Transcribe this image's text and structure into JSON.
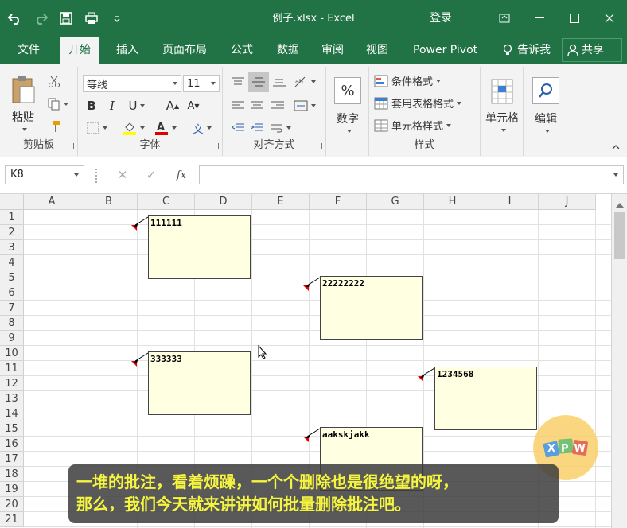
{
  "window": {
    "title": "例子.xlsx  -  Excel",
    "login": "登录"
  },
  "tabs": [
    "文件",
    "开始",
    "插入",
    "页面布局",
    "公式",
    "数据",
    "审阅",
    "视图",
    "Power Pivot",
    "告诉我",
    "共享"
  ],
  "ribbon": {
    "clipboard": {
      "label": "剪贴板",
      "paste": "粘贴"
    },
    "font": {
      "label": "字体",
      "name": "等线",
      "size": "11",
      "bold": "B",
      "italic": "I",
      "underline": "U",
      "grow": "A",
      "shrink": "A",
      "wen": "文"
    },
    "align": {
      "label": "对齐方式"
    },
    "number": {
      "label": "数字",
      "symbol": "%"
    },
    "styles": {
      "label": "样式",
      "cond": "条件格式",
      "table": "套用表格格式",
      "cell": "单元格样式"
    },
    "cells": {
      "label": "单元格"
    },
    "edit": {
      "label": "编辑"
    }
  },
  "formula_bar": {
    "name_box": "K8",
    "fx": "fx",
    "content": ""
  },
  "columns": [
    "A",
    "B",
    "C",
    "D",
    "E",
    "F",
    "G",
    "H",
    "I",
    "J"
  ],
  "rows": [
    "1",
    "2",
    "3",
    "4",
    "5",
    "6",
    "7",
    "8",
    "9",
    "10",
    "11",
    "12",
    "13",
    "14",
    "15",
    "16",
    "17",
    "18",
    "19",
    "20",
    "21"
  ],
  "comments": [
    {
      "cell": "B2",
      "text": "111111"
    },
    {
      "cell": "E6",
      "text": "22222222"
    },
    {
      "cell": "B11",
      "text": "333333"
    },
    {
      "cell": "G12",
      "text": "1234568"
    },
    {
      "cell": "E16",
      "text": "aakskjakk"
    }
  ],
  "caption": {
    "line1": "一堆的批注，看着烦躁，一个个删除也是很绝望的呀，",
    "line2": "那么，我们今天就来讲讲如何批量删除批注吧。"
  },
  "logo": {
    "letters": "XPW"
  }
}
